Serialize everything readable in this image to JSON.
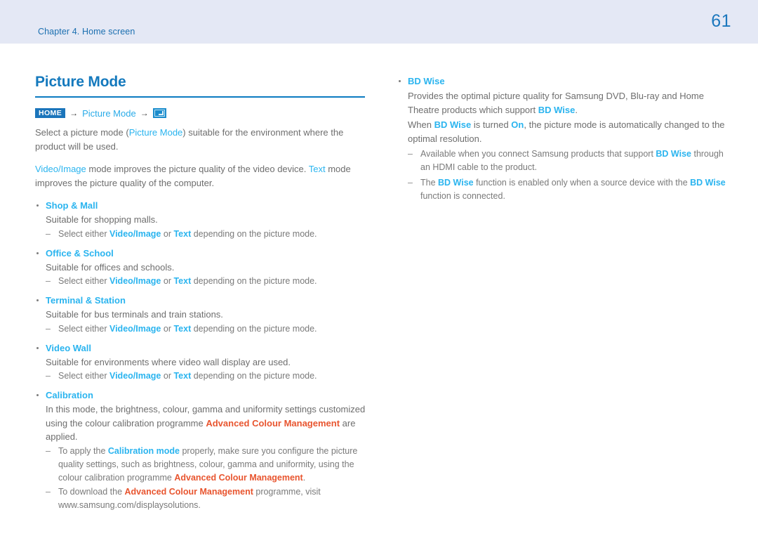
{
  "header": {
    "chapter": "Chapter 4. Home screen",
    "page_number": "61",
    "bg_color": "#e4e8f5",
    "text_color": "#1b6fb0"
  },
  "title": "Picture Mode",
  "breadcrumb": {
    "home_label": "HOME",
    "arrow1": "→",
    "link_label": "Picture Mode",
    "arrow2": "→",
    "enter_icon": "enter-key-icon"
  },
  "left_column": {
    "intro1_a": "Select a picture mode (",
    "intro1_link": "Picture Mode",
    "intro1_b": ") suitable for the environment where the product will be used.",
    "intro2_link1": "Video/Image",
    "intro2_a": " mode improves the picture quality of the video device. ",
    "intro2_link2": "Text",
    "intro2_b": " mode improves the picture quality of the computer.",
    "bullets": [
      {
        "head": "Shop & Mall",
        "desc": "Suitable for shopping malls.",
        "dashes": [
          {
            "a": "Select either ",
            "l1": "Video/Image",
            "b": " or ",
            "l2": "Text",
            "c": " depending on the picture mode."
          }
        ]
      },
      {
        "head": "Office & School",
        "desc": "Suitable for offices and schools.",
        "dashes": [
          {
            "a": "Select either ",
            "l1": "Video/Image",
            "b": " or ",
            "l2": "Text",
            "c": " depending on the picture mode."
          }
        ]
      },
      {
        "head": "Terminal & Station",
        "desc": "Suitable for bus terminals and train stations.",
        "dashes": [
          {
            "a": "Select either ",
            "l1": "Video/Image",
            "b": " or ",
            "l2": "Text",
            "c": " depending on the picture mode."
          }
        ]
      },
      {
        "head": "Video Wall",
        "desc": "Suitable for environments where video wall display are used.",
        "dashes": [
          {
            "a": "Select either ",
            "l1": "Video/Image",
            "b": " or ",
            "l2": "Text",
            "c": " depending on the picture mode."
          }
        ]
      },
      {
        "head": "Calibration",
        "desc_a": "In this mode, the brightness, colour, gamma and uniformity settings customized using the colour calibration programme ",
        "desc_red": "Advanced Colour Management",
        "desc_b": " are applied.",
        "dash1_a": "To apply the ",
        "dash1_cy": "Calibration mode",
        "dash1_b": " properly, make sure you configure the picture quality settings, such as brightness, colour, gamma and uniformity, using the colour calibration programme ",
        "dash1_red": "Advanced Colour Management",
        "dash1_c": ".",
        "dash2_a": "To download the ",
        "dash2_red": "Advanced Colour Management",
        "dash2_b": " programme, visit www.samsung.com/displaysolutions."
      }
    ]
  },
  "right_column": {
    "bullet_head": "BD Wise",
    "p1_a": "Provides the optimal picture quality for Samsung DVD, Blu-ray and Home Theatre products which support ",
    "p1_link": "BD Wise",
    "p1_b": ".",
    "p2_a": "When ",
    "p2_link1": "BD Wise",
    "p2_b": " is turned ",
    "p2_link2": "On",
    "p2_c": ", the picture mode is automatically changed to the optimal resolution.",
    "dash1_a": "Available when you connect Samsung products that support ",
    "dash1_link": "BD Wise",
    "dash1_b": " through an HDMI cable to the product.",
    "dash2_a": "The ",
    "dash2_link1": "BD Wise",
    "dash2_b": " function is enabled only when a source device with the ",
    "dash2_link2": "BD Wise",
    "dash2_c": " function is connected."
  },
  "colors": {
    "title_blue": "#1479bd",
    "link_cyan": "#2ab4ef",
    "accent_red": "#e8552f",
    "body_gray": "#6e6e6e",
    "badge_blue": "#1b75bb"
  }
}
